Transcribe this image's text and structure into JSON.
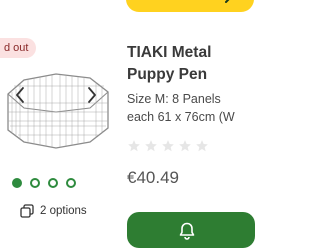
{
  "gallery": {
    "badge": "d out",
    "image_alt": "TIAKI Metal Puppy Pen",
    "dots_total": 4,
    "active_dot": 0,
    "options_label": "2 options"
  },
  "product": {
    "title_line1": "TIAKI Metal",
    "title_line2": "Puppy Pen",
    "size_line1": "Size M: 8 Panels",
    "size_line2": "each 61 x 76cm (W",
    "rating": 0,
    "rating_max": 5,
    "price": "€40.49"
  },
  "colors": {
    "accent_green": "#2e7d32",
    "accent_yellow": "#ffd21f",
    "badge_bg": "#fbe1e1"
  },
  "icons": {
    "prev": "chevron-left-icon",
    "next": "chevron-right-icon",
    "options": "variants-icon",
    "cart_top": "arrow-icon",
    "cart_button": "bell-icon",
    "star": "star-icon"
  }
}
